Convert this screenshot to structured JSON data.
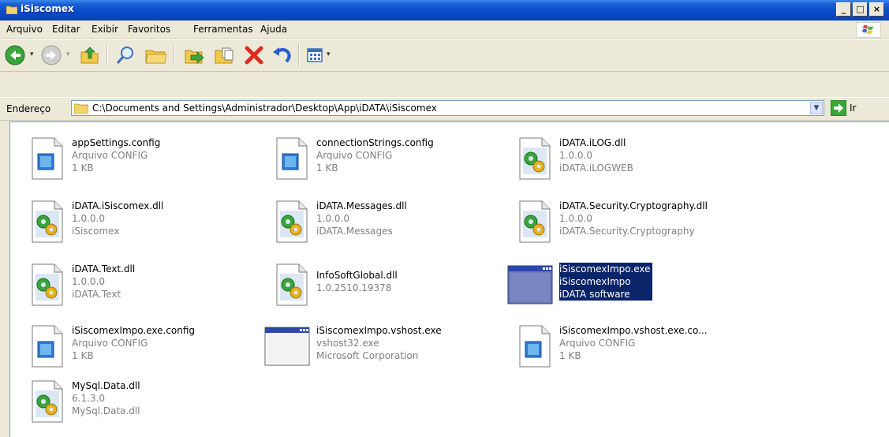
{
  "window": {
    "title": "iSiscomex",
    "controls": [
      "_",
      "□",
      "×"
    ]
  },
  "menu": [
    {
      "label": "Arquivo",
      "icon": null
    },
    {
      "label": "Editar"
    },
    {
      "label": "Exibir"
    },
    {
      "label": "Favoritos"
    },
    {
      "label": "Ferramentas"
    },
    {
      "label": "Ajuda"
    }
  ],
  "toolbar": {
    "buttons": [
      "back-icon",
      "forward-icon",
      "up-folder-icon",
      "search-icon",
      "folders-icon",
      "move-to-icon",
      "copy-to-icon",
      "delete-icon",
      "undo-icon",
      "views-icon"
    ]
  },
  "address": {
    "label": "Endereço",
    "path": "C:\\Documents and Settings\\Administrador\\Desktop\\App\\iDATA\\iSiscomex",
    "go_label": "Ir"
  },
  "files": [
    {
      "name": "appSettings.config",
      "line2": "Arquivo CONFIG",
      "line3": "1 KB",
      "icon": "config-file-icon",
      "selected": false
    },
    {
      "name": "connectionStrings.config",
      "line2": "Arquivo CONFIG",
      "line3": "1 KB",
      "icon": "config-file-icon",
      "selected": false
    },
    {
      "name": "iDATA.iLOG.dll",
      "line2": "1.0.0.0",
      "line3": "iDATA.iLOGWEB",
      "icon": "dll-file-icon",
      "selected": false
    },
    {
      "name": "iDATA.iSiscomex.dll",
      "line2": "1.0.0.0",
      "line3": "iSiscomex",
      "icon": "dll-file-icon",
      "selected": false
    },
    {
      "name": "iDATA.Messages.dll",
      "line2": "1.0.0.0",
      "line3": "iDATA.Messages",
      "icon": "dll-file-icon",
      "selected": false
    },
    {
      "name": "iDATA.Security.Cryptography.dll",
      "line2": "1.0.0.0",
      "line3": "iDATA.Security.Cryptography",
      "icon": "dll-file-icon",
      "selected": false
    },
    {
      "name": "iDATA.Text.dll",
      "line2": "1.0.0.0",
      "line3": "iDATA.Text",
      "icon": "dll-file-icon",
      "selected": false
    },
    {
      "name": "InfoSoftGlobal.dll",
      "line2": "1.0.2510.19378",
      "line3": "",
      "icon": "dll-file-icon",
      "selected": false
    },
    {
      "name": "iSiscomexImpo.exe",
      "line2": "iSiscomexImpo",
      "line3": "iDATA software",
      "icon": "exe-window-icon",
      "selected": true
    },
    {
      "name": "iSiscomexImpo.exe.config",
      "line2": "Arquivo CONFIG",
      "line3": "1 KB",
      "icon": "config-file-icon",
      "selected": false
    },
    {
      "name": "iSiscomexImpo.vshost.exe",
      "line2": "vshost32.exe",
      "line3": "Microsoft Corporation",
      "icon": "exe-window-icon",
      "selected": false
    },
    {
      "name": "iSiscomexImpo.vshost.exe.co...",
      "line2": "Arquivo CONFIG",
      "line3": "1 KB",
      "icon": "config-file-icon",
      "selected": false
    },
    {
      "name": "MySql.Data.dll",
      "line2": "6.1.3.0",
      "line3": "MySql.Data.dll",
      "icon": "dll-file-icon",
      "selected": false
    }
  ],
  "colors": {
    "titlebar": "#0a4cc8",
    "selection": "#0a246a",
    "meta_text": "#808080"
  }
}
